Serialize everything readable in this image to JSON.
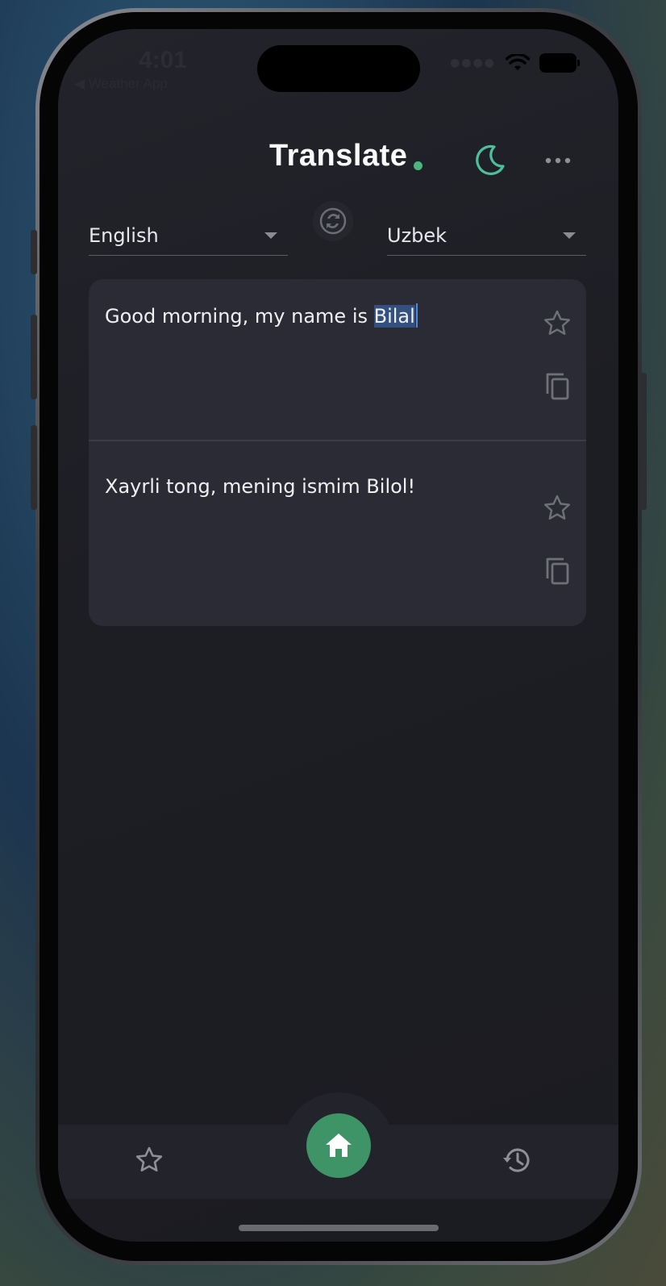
{
  "status_bar": {
    "time": "4:01",
    "back_app": "◀ Weather App"
  },
  "header": {
    "title": "Translate",
    "accent_color": "#4cb47c",
    "theme_icon": "moon-icon",
    "menu_icon": "more-horizontal-icon"
  },
  "languages": {
    "source": "English",
    "target": "Uzbek",
    "swap_icon": "swap-icon"
  },
  "source_panel": {
    "text_before": "Good morning, my name is ",
    "text_selected": "Bilal",
    "favorite_icon": "star-outline-icon",
    "copy_icon": "copy-icon"
  },
  "target_panel": {
    "text": "Xayrli tong, mening ismim Bilol!",
    "favorite_icon": "star-outline-icon",
    "copy_icon": "copy-icon"
  },
  "bottom_nav": {
    "favorites_icon": "star-outline-icon",
    "home_icon": "home-icon",
    "history_icon": "history-icon",
    "home_color": "#3e9466"
  }
}
